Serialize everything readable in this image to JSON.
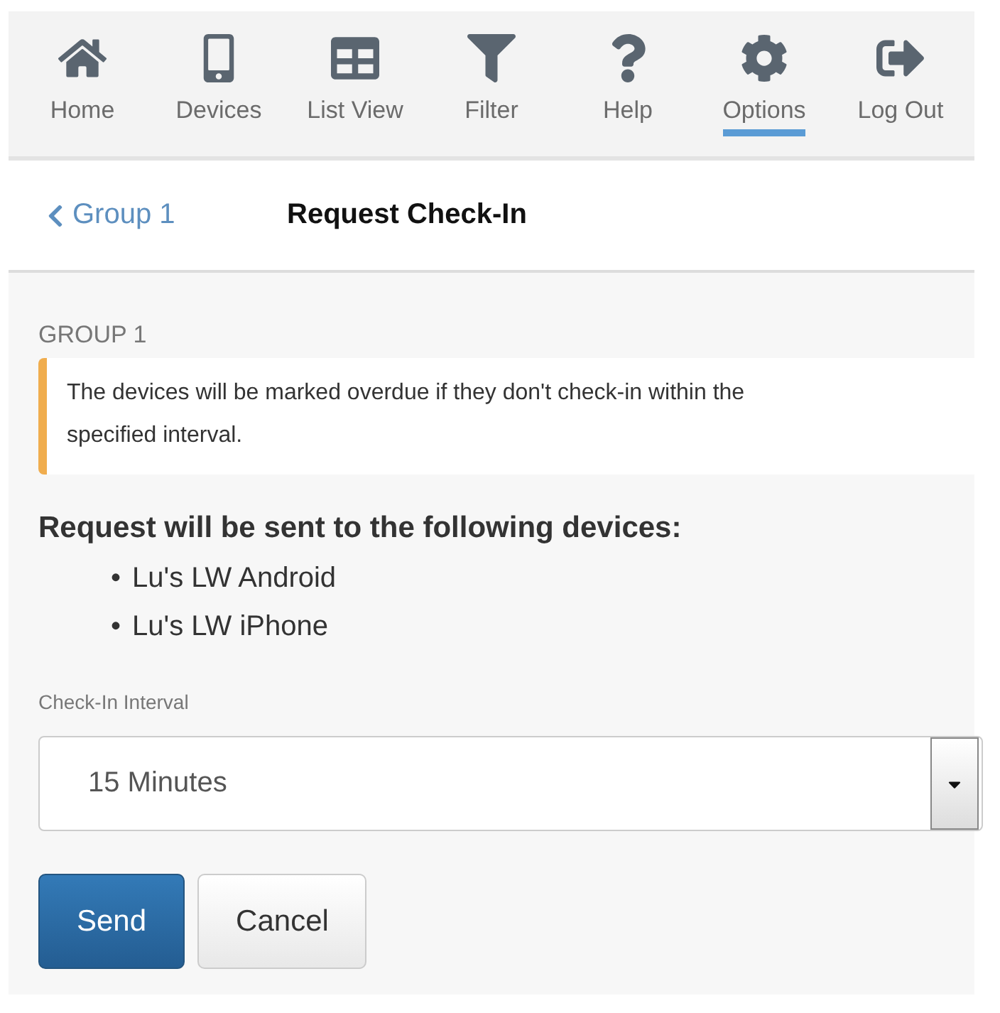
{
  "nav": [
    {
      "kind": "home",
      "label": "Home",
      "selected": false
    },
    {
      "kind": "device",
      "label": "Devices",
      "selected": false
    },
    {
      "kind": "grid",
      "label": "List View",
      "selected": false
    },
    {
      "kind": "filter",
      "label": "Filter",
      "selected": false
    },
    {
      "kind": "help",
      "label": "Help",
      "selected": false
    },
    {
      "kind": "gear",
      "label": "Options",
      "selected": true
    },
    {
      "kind": "logout",
      "label": "Log Out",
      "selected": false
    }
  ],
  "header": {
    "back": "Group 1",
    "title": "Request Check-In"
  },
  "section_label": "GROUP 1",
  "alert": "The devices will be marked overdue if they don't check-in within the specified interval.",
  "recipients": {
    "heading": "Request will be sent to the following devices:",
    "devices": [
      {
        "bullet": "•",
        "name": "Lu's LW Android"
      },
      {
        "bullet": "•",
        "name": "Lu's LW iPhone"
      }
    ]
  },
  "interval": {
    "label": "Check-In Interval",
    "value": "15 Minutes"
  },
  "buttons": [
    {
      "kind": "primary",
      "label": "Send"
    },
    {
      "kind": "default",
      "label": "Cancel"
    }
  ]
}
